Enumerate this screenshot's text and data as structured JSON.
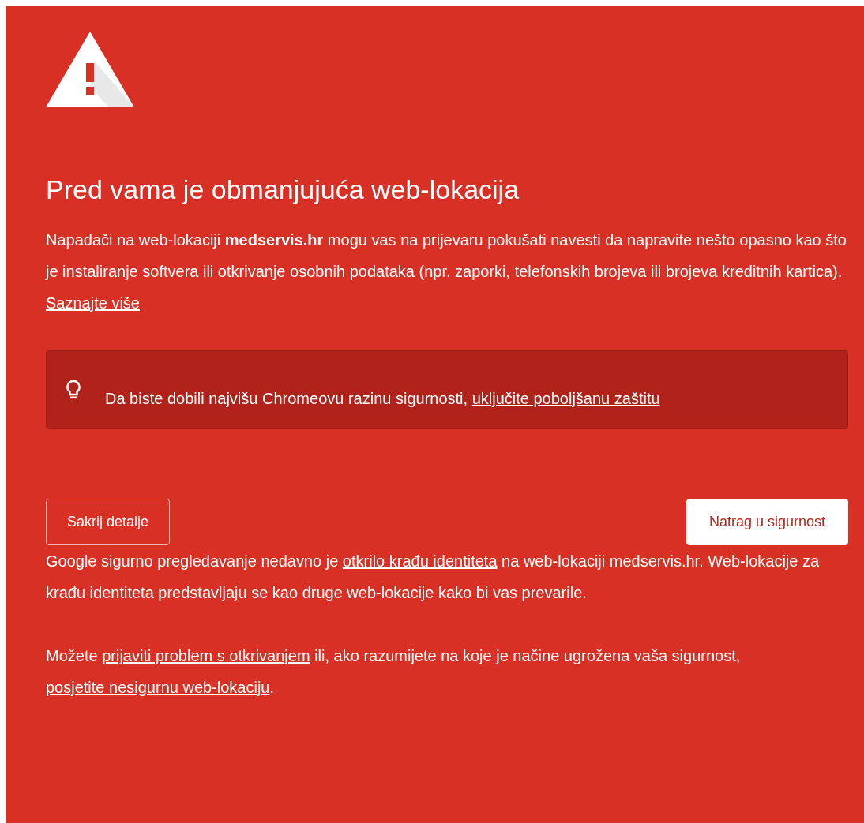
{
  "heading": "Pred vama je obmanjujuća web-lokacija",
  "intro": {
    "text": "Napadači na web-lokaciji **medservis.hr** mogu vas na prijevaru pokušati navesti da napravite nešto opasno kao što je instaliranje softvera ili otkrivanje osobnih podataka (npr. zaporki, telefonskih brojeva ili brojeva kreditnih kartica).",
    "link": "Saznajte više"
  },
  "tip": {
    "text": "Da biste dobili najvišu Chromeovu razinu sigurnosti,",
    "link": "uključite poboljšanu zaštitu"
  },
  "buttons": [
    {
      "kind": "secondary",
      "label": "Sakrij detalje"
    },
    {
      "kind": "primary",
      "label": "Natrag u sigurnost"
    }
  ],
  "details": [
    {
      "parts": [
        {
          "kind": "text",
          "text": "Google sigurno pregledavanje nedavno je "
        },
        {
          "kind": "link",
          "text": "otkrilo krađu identiteta"
        },
        {
          "kind": "text",
          "text": " na web-lokaciji medservis.hr. Web-lokacije za krađu identiteta predstavljaju se kao druge web-lokacije kako bi vas prevarile."
        }
      ]
    },
    {
      "parts": [
        {
          "kind": "text",
          "text": "Možete "
        },
        {
          "kind": "link",
          "text": "prijaviti problem s otkrivanjem"
        },
        {
          "kind": "text",
          "text": " ili, ako razumijete na koje je načine ugrožena vaša sigurnost, "
        },
        {
          "kind": "link",
          "text": "posjetite nesigurnu web-lokaciju"
        },
        {
          "kind": "text",
          "text": "."
        }
      ]
    }
  ]
}
